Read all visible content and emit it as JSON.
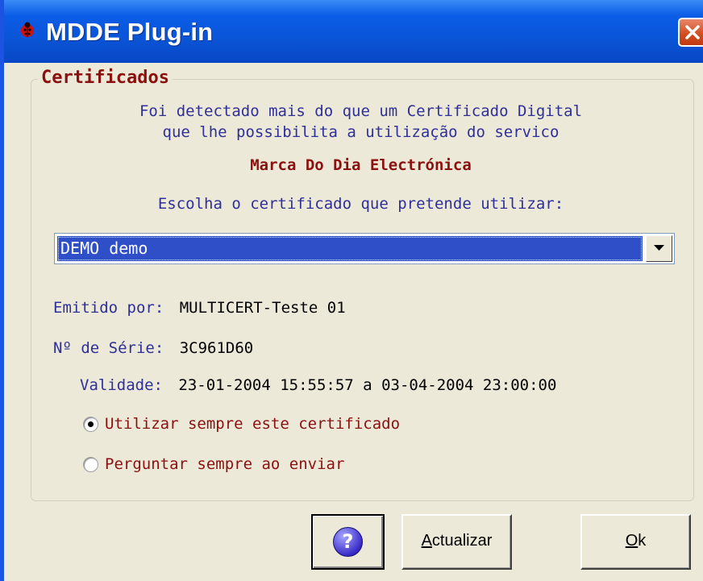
{
  "window": {
    "title": "MDDE Plug-in"
  },
  "group": {
    "legend": "Certificados"
  },
  "intro": {
    "line1": "Foi detectado mais do que um Certificado Digital",
    "line2": "que lhe possibilita a utilização do servico",
    "service": "Marca Do Dia Electrónica",
    "prompt": "Escolha o certificado que pretende utilizar:"
  },
  "certificate_select": {
    "selected": "DEMO demo"
  },
  "details": {
    "issuer_label": "Emitido por:",
    "issuer_value": "MULTICERT-Teste 01",
    "serial_label": "Nº de Série:",
    "serial_value": "3C961D60",
    "validity_label": "Validade:",
    "validity_value": "23-01-2004 15:55:57 a 03-04-2004 23:00:00"
  },
  "options": [
    {
      "label": "Utilizar sempre este certificado",
      "checked": true
    },
    {
      "label": "Perguntar sempre ao enviar",
      "checked": false
    }
  ],
  "buttons": {
    "help_glyph": "?",
    "update_first": "A",
    "update_rest": "ctualizar",
    "ok_first": "O",
    "ok_rest": "k"
  },
  "colors": {
    "titlebar": "#0a55d8",
    "label_blue": "#2f2f9a",
    "accent_red": "#8b1010",
    "selection": "#2f4fc8",
    "dialog_bg": "#ece9d8"
  },
  "icons": {
    "app": "ladybug-icon",
    "close": "close-icon",
    "help": "help-icon",
    "dropdown": "dropdown-arrow-icon"
  }
}
